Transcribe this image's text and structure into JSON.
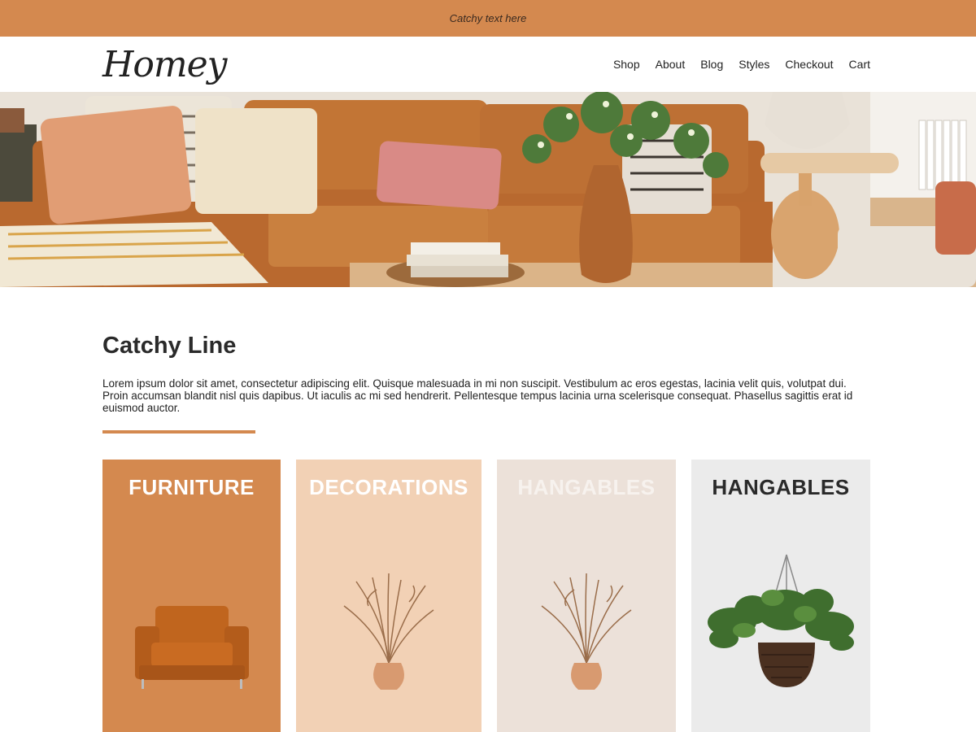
{
  "topbar": {
    "text": "Catchy text here",
    "background": "#d4894f"
  },
  "header": {
    "logo": "Homey",
    "nav": [
      {
        "label": "Shop"
      },
      {
        "label": "About"
      },
      {
        "label": "Blog"
      },
      {
        "label": "Styles"
      },
      {
        "label": "Checkout"
      },
      {
        "label": "Cart"
      }
    ]
  },
  "hero": {
    "image": "living-room-leather-sofa-photo"
  },
  "intro": {
    "title": "Catchy Line",
    "body": "Lorem ipsum dolor sit amet, consectetur adipiscing elit. Quisque malesuada in mi non suscipit. Vestibulum ac eros egestas, lacinia velit quis, volutpat dui. Proin accumsan blandit nisl quis dapibus. Ut iaculis ac mi sed hendrerit. Pellentesque tempus lacinia urna scelerisque consequat. Phasellus sagittis erat id euismod auctor.",
    "accent": "#d4894f"
  },
  "categories": [
    {
      "label": "FURNITURE",
      "background": "#d4894f",
      "text_color": "#ffffff",
      "image": "armchair-image"
    },
    {
      "label": "DECORATIONS",
      "background": "#f2d1b5",
      "text_color": "#ffffff",
      "image": "vase-branches-image"
    },
    {
      "label": "HANGABLES",
      "background": "#ece1d9",
      "text_color": "#f7f2ee",
      "image": "vase-branches-image"
    },
    {
      "label": "HANGABLES",
      "background": "#ebebeb",
      "text_color": "#2a2a2a",
      "image": "hanging-plant-image"
    }
  ]
}
